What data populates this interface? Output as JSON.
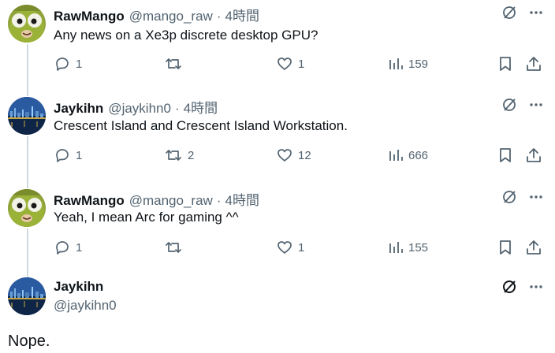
{
  "tweets": [
    {
      "name": "RawMango",
      "handle": "@mango_raw",
      "dot": "·",
      "time": "4時間",
      "text": "Any news on a Xe3p discrete desktop GPU?",
      "replies": "1",
      "retweets": "",
      "likes": "1",
      "views": "159",
      "avatar": "frog-avatar"
    },
    {
      "name": "Jaykihn",
      "handle": "@jaykihn0",
      "dot": "·",
      "time": "4時間",
      "text": "Crescent Island and Crescent Island Workstation.",
      "replies": "1",
      "retweets": "2",
      "likes": "12",
      "views": "666",
      "avatar": "night-city-avatar"
    },
    {
      "name": "RawMango",
      "handle": "@mango_raw",
      "dot": "·",
      "time": "4時間",
      "text": "Yeah, I mean Arc for gaming ^^",
      "replies": "1",
      "retweets": "",
      "likes": "1",
      "views": "155",
      "avatar": "frog-avatar"
    }
  ],
  "focused": {
    "name": "Jaykihn",
    "handle": "@jaykihn0",
    "text": "Nope.",
    "avatar": "night-city-avatar"
  },
  "colors": {
    "secondary": "#536471",
    "text": "#0f1419",
    "thread_line": "#cfd9de"
  }
}
